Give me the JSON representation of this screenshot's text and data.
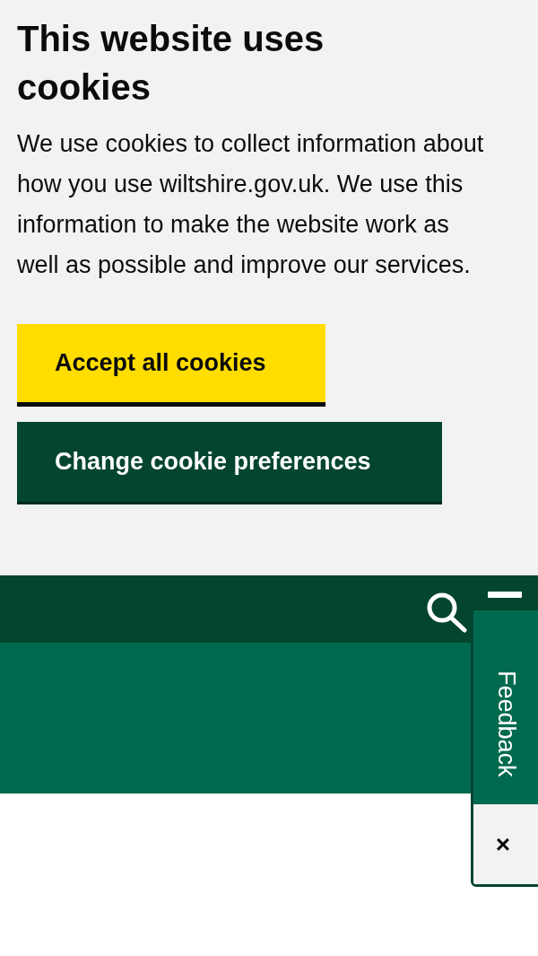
{
  "cookie_banner": {
    "title": "This website uses cookies",
    "body": "We use cookies to collect information about how you use wiltshire.gov.uk. We use this information to make the website work as well as possible and improve our services.",
    "buttons": [
      {
        "label": "Accept all cookies",
        "kind": "primary"
      },
      {
        "label": "Change cookie preferences",
        "kind": "secondary"
      }
    ]
  },
  "feedback_tab": {
    "label": "Feedback",
    "close": "×"
  }
}
